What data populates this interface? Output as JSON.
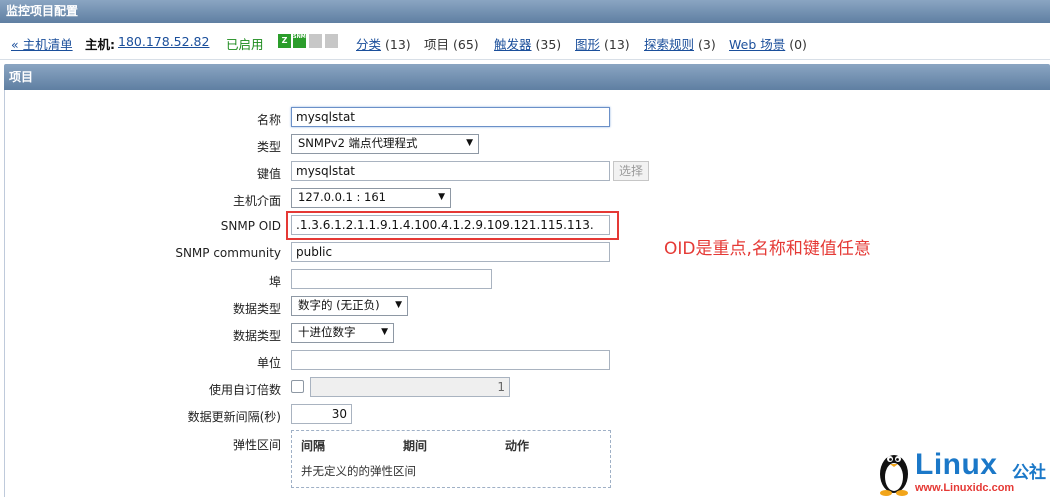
{
  "window": {
    "title": "监控项目配置"
  },
  "nav": {
    "back_label": "« 主机清单",
    "host_prefix": "主机:",
    "host_name": "180.178.52.82",
    "status": "已启用",
    "badges": {
      "z": "Z",
      "snmp": "SNMP"
    },
    "links": [
      {
        "label": "分类",
        "count": "(13)"
      },
      {
        "label": "项目",
        "count": "(65)"
      },
      {
        "label": "触发器",
        "count": "(35)"
      },
      {
        "label": "图形",
        "count": "(13)"
      },
      {
        "label": "探索规则",
        "count": "(3)"
      },
      {
        "label": "Web 场景",
        "count": "(0)"
      }
    ]
  },
  "section": {
    "title": "项目"
  },
  "form": {
    "name": {
      "label": "名称",
      "value": "mysqlstat"
    },
    "type": {
      "label": "类型",
      "value": "SNMPv2 端点代理程式"
    },
    "key": {
      "label": "键值",
      "value": "mysqlstat",
      "button": "选择"
    },
    "interface": {
      "label": "主机介面",
      "value": "127.0.0.1 : 161"
    },
    "oid": {
      "label": "SNMP OID",
      "value": ".1.3.6.1.2.1.1.9.1.4.100.4.1.2.9.109.121.115.113."
    },
    "community": {
      "label": "SNMP community",
      "value": "public"
    },
    "port": {
      "label": "埠",
      "value": ""
    },
    "data_type": {
      "label": "数据类型",
      "value": "数字的 (无正负)"
    },
    "data_format": {
      "label": "数据类型",
      "value": "十进位数字"
    },
    "unit": {
      "label": "单位",
      "value": ""
    },
    "multiplier": {
      "label": "使用自订倍数",
      "value": "1"
    },
    "interval": {
      "label": "数据更新间隔(秒)",
      "value": "30"
    },
    "flex": {
      "label": "弹性区间",
      "columns": [
        "间隔",
        "期间",
        "动作"
      ],
      "empty": "并无定义的的弹性区间"
    }
  },
  "annotation": {
    "text": "OID是重点,名称和键值任意"
  },
  "watermark": {
    "brand": "Linux",
    "brand_suffix": "公社",
    "url": "www.Linuxidc.com"
  },
  "colors": {
    "header": "#6f8db0",
    "link": "#1b4f9b",
    "annotation": "#e53935",
    "enabled": "#1b8a1b"
  }
}
